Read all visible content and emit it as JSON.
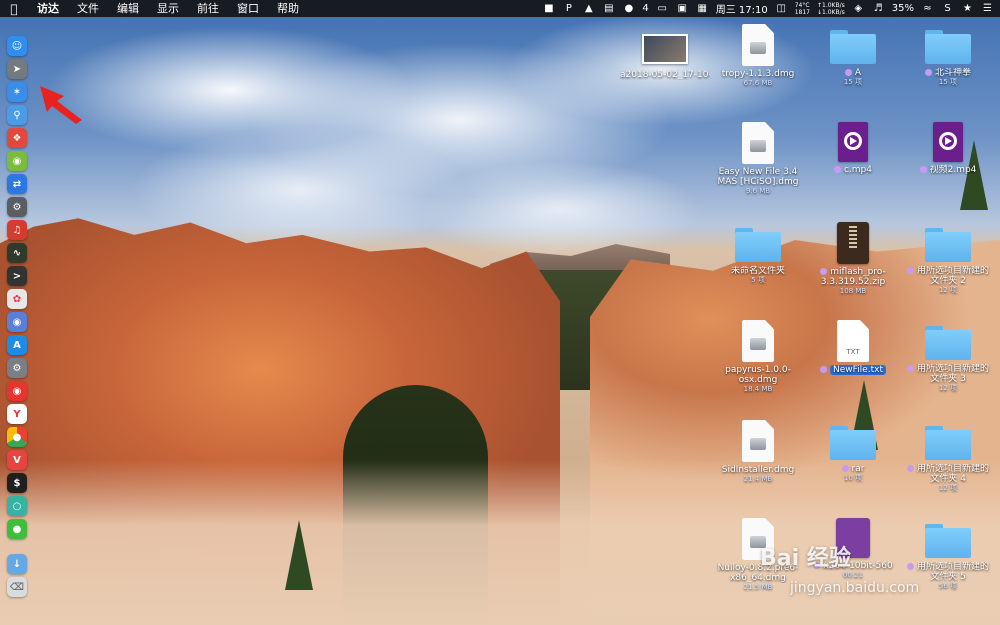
{
  "menubar": {
    "app_name": "访达",
    "menus": [
      "文件",
      "编辑",
      "显示",
      "前往",
      "窗口",
      "帮助"
    ],
    "tray_badge": "4",
    "cpu_temp": "74°C",
    "cpu_rpm": "1817",
    "net_up": "↑1.0KB/s",
    "net_down": "↓1.0KB/s",
    "clock": "周三 17:10",
    "battery_percent": "35%"
  },
  "dock": {
    "items": [
      {
        "name": "finder",
        "color": "#2f8ff0"
      },
      {
        "name": "launchpad",
        "color": "#737a80"
      },
      {
        "name": "safari",
        "color": "#3a8de8"
      },
      {
        "name": "preview",
        "color": "#4b9be6"
      },
      {
        "name": "xmind",
        "color": "#e2483b"
      },
      {
        "name": "android",
        "color": "#7cbc3b"
      },
      {
        "name": "teamviewer",
        "color": "#2b78e4"
      },
      {
        "name": "gear",
        "color": "#5a5e63"
      },
      {
        "name": "netease-music",
        "color": "#d63b2f"
      },
      {
        "name": "activity-monitor",
        "color": "#2e3a2a"
      },
      {
        "name": "terminal-app",
        "color": "#333333"
      },
      {
        "name": "photos",
        "color": "#e7e7e7"
      },
      {
        "name": "siri",
        "color": "#5a7fd8"
      },
      {
        "name": "app-store",
        "color": "#1d8ce6"
      },
      {
        "name": "system-prefs",
        "color": "#7a7f85"
      },
      {
        "name": "weibo",
        "color": "#e4352f"
      },
      {
        "name": "yandex",
        "color": "#ffffff"
      },
      {
        "name": "chrome",
        "color": "#f5c242"
      },
      {
        "name": "vivaldi",
        "color": "#e6443f"
      },
      {
        "name": "iterm",
        "color": "#1f1f1f"
      },
      {
        "name": "airdroid",
        "color": "#35b3a3"
      },
      {
        "name": "wechat",
        "color": "#3dbf3a"
      },
      {
        "name": "downloads",
        "color": "#64a9e6"
      },
      {
        "name": "trash",
        "color": "#d9dcdf"
      }
    ]
  },
  "desktop": {
    "icons": [
      {
        "id": "jpg",
        "label": "a2018-05-02_17-10-55.jpg",
        "sub": ""
      },
      {
        "id": "tropy",
        "label": "tropy-1.1.3.dmg",
        "sub": "67.6 MB"
      },
      {
        "id": "folder-a",
        "label": "A",
        "sub": "15 项"
      },
      {
        "id": "folder-beidou",
        "label": "北斗神拳",
        "sub": "15 项"
      },
      {
        "id": "easynewfile",
        "label": "Easy New File 3.4 MAS [HCiSO].dmg",
        "sub": "9.6 MB"
      },
      {
        "id": "c-mp4",
        "label": "c.mp4",
        "sub": ""
      },
      {
        "id": "video2",
        "label": "视频2.mp4",
        "sub": ""
      },
      {
        "id": "untitled-folder",
        "label": "未命名文件夹",
        "sub": "5 项"
      },
      {
        "id": "miflash",
        "label": "miflash_pro-3.3.319.52.zip",
        "sub": "108 MB"
      },
      {
        "id": "newfolder2",
        "label": "用所选项目新建的文件夹 2",
        "sub": "12 项"
      },
      {
        "id": "papyrus",
        "label": "papyrus-1.0.0-osx.dmg",
        "sub": "18.4 MB"
      },
      {
        "id": "newfile",
        "label": "NewFile.txt",
        "sub": "",
        "ext": "TXT"
      },
      {
        "id": "newfolder3",
        "label": "用所选项目新建的文件夹 3",
        "sub": "12 项"
      },
      {
        "id": "sidinstaller",
        "label": "SidInstaller.dmg",
        "sub": "21.4 MB"
      },
      {
        "id": "rar",
        "label": "rar",
        "sub": "10 项"
      },
      {
        "id": "newfolder4",
        "label": "用所选项目新建的文件夹 4",
        "sub": "12 项"
      },
      {
        "id": "nulloy",
        "label": "Nulloy-0.8.2.pre6-x86_64.dmg",
        "sub": "21.5 MB"
      },
      {
        "id": "x264",
        "label": "x264-10bit-560",
        "sub": "00:21"
      },
      {
        "id": "newfolder5",
        "label": "用所选项目新建的文件夹 5",
        "sub": "56 项"
      }
    ]
  },
  "watermark": {
    "brand": "Bai 经验",
    "url": "jingyan.baidu.com"
  }
}
